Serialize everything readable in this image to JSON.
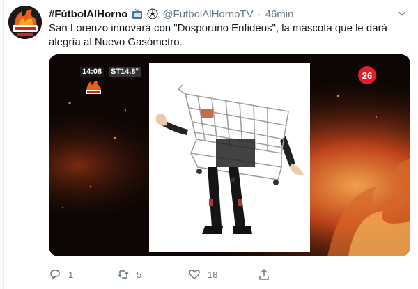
{
  "tweet": {
    "display_name": "#FútbolAlHorno",
    "handle": "@FutbolAlHornoTV",
    "separator": "·",
    "time": "46min",
    "text": "San Lorenzo innovará con \"Dosporuno Enfideos\", la mascota que le dará alegría al Nuevo Gasómetro."
  },
  "media": {
    "overlay_time": "14:08",
    "overlay_temp": "ST14.8°",
    "channel_number": "26"
  },
  "actions": {
    "reply_count": "1",
    "retweet_count": "5",
    "like_count": "18"
  },
  "icons": {
    "tv": "tv-emoji-icon",
    "ball": "soccer-ball-emoji-icon",
    "caret": "chevron-down-icon",
    "reply": "reply-icon",
    "retweet": "retweet-icon",
    "like": "heart-icon",
    "share": "share-icon"
  },
  "colors": {
    "text": "#14171a",
    "secondary": "#657786",
    "fire": "#c0451b",
    "channel_red": "#e0202a"
  }
}
